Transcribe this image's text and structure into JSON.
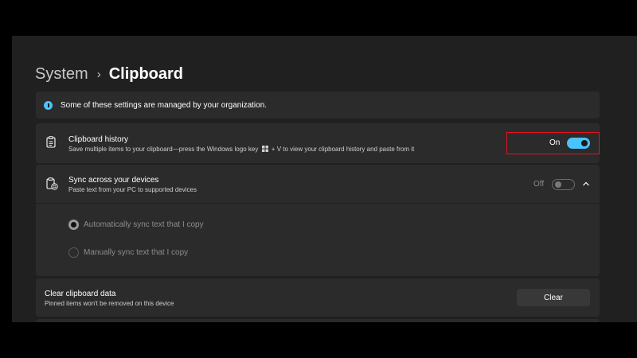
{
  "breadcrumb": {
    "parent": "System",
    "separator": "›",
    "current": "Clipboard"
  },
  "info_bar": {
    "icon": "info-icon",
    "text": "Some of these settings are managed by your organization."
  },
  "clipboard_history": {
    "icon": "clipboard-icon",
    "title": "Clipboard history",
    "subtitle_pre": "Save multiple items to your clipboard—press the Windows logo key",
    "subtitle_post": "+ V to view your clipboard history and paste from it",
    "toggle_label": "On",
    "toggle_state": "on"
  },
  "sync": {
    "icon": "clipboard-sync-icon",
    "title": "Sync across your devices",
    "subtitle": "Paste text from your PC to supported devices",
    "toggle_label": "Off",
    "toggle_state": "off",
    "expanded": true,
    "options": [
      {
        "label": "Automatically sync text that I copy",
        "selected": true
      },
      {
        "label": "Manually sync text that I copy",
        "selected": false
      }
    ]
  },
  "clear_data": {
    "title": "Clear clipboard data",
    "subtitle": "Pinned items won't be removed on this device",
    "button_label": "Clear"
  },
  "colors": {
    "accent": "#4cc2ff",
    "highlight_border": "#e81123",
    "background": "#202020",
    "card": "#2b2b2b"
  }
}
